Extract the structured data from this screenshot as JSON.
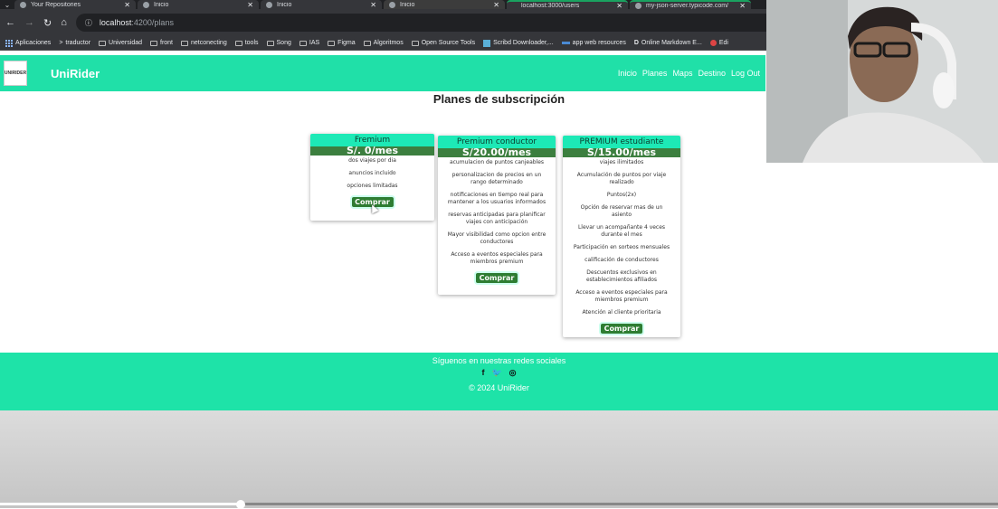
{
  "browser": {
    "tabs": [
      {
        "title": "Your Repositories"
      },
      {
        "title": "Inicio"
      },
      {
        "title": "Inicio"
      },
      {
        "title": "Inicio"
      },
      {
        "title": "localhost:3000/users"
      },
      {
        "title": "my-json-server.typicode.com/"
      }
    ],
    "url_host": "localhost",
    "url_path": ":4200/plans",
    "bookmarks": [
      "Aplicaciones",
      "traductor",
      "Universidad",
      "front",
      "netconecting",
      "tools",
      "Song",
      "IAS",
      "Figma",
      "Algoritmos",
      "Open Source Tools",
      "Scribd Downloader,...",
      "app web resources",
      "Online Markdown E...",
      "Edi"
    ]
  },
  "navbar": {
    "brand": "UniRider",
    "logo_text": "UNIRIDER",
    "links": [
      "Inicio",
      "Planes",
      "Maps",
      "Destino",
      "Log Out"
    ]
  },
  "page_title": "Planes de subscripción",
  "plans": [
    {
      "name": "Fremium",
      "price": "S/. 0/mes",
      "features": [
        "dos viajes por dia",
        "anuncios incluido",
        "opciones limitadas"
      ],
      "button": "Comprar"
    },
    {
      "name": "Premium conductor",
      "price": "S/20.00/mes",
      "features": [
        "acumulacion de puntos canjeables",
        "personalizacion de precios en un rango determinado",
        "notificaciones en tiempo real para mantener a los usuarios informados",
        "reservas anticipadas para planificar viajes con anticipación",
        "Mayor visibilidad como opcion entre conductores",
        "Acceso a eventos especiales para miembros premium"
      ],
      "button": "Comprar"
    },
    {
      "name": "PREMIUM estudiante",
      "price": "S/15.00/mes",
      "features": [
        "viajes ilimitados",
        "Acumulación de puntos por viaje realizado",
        "Puntos(2x)",
        "Opción de reservar mas de un asiento",
        "Llevar un acompañante 4 veces durante el mes",
        "Participación en sorteos mensuales",
        "calificación de conductores",
        "Descuentos exclusivos en establecimientos afiliados",
        "Acceso a eventos especiales para miembros premium",
        "Atención al cliente prioritaria"
      ],
      "button": "Comprar"
    }
  ],
  "footer": {
    "follow": "Síguenos en nuestras redes sociales",
    "social_icons": [
      "f",
      "t",
      "ig"
    ],
    "copyright": "© 2024 UniRider"
  }
}
